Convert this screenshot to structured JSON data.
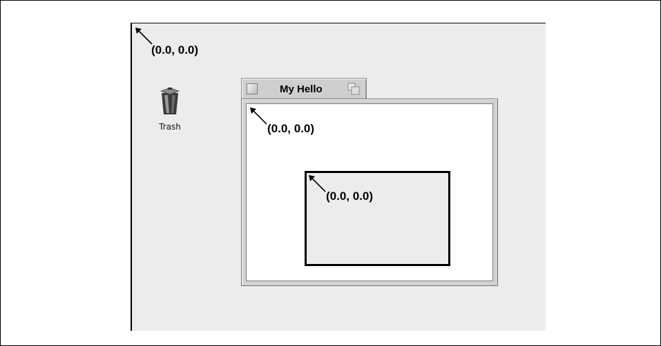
{
  "desktop": {
    "origin_label": "(0.0, 0.0)",
    "trash": {
      "label": "Trash",
      "icon": "trash-can-icon"
    }
  },
  "window": {
    "title": "My Hello",
    "close_icon": "close-box-icon",
    "zoom_icon": "zoom-box-icon",
    "origin_label": "(0.0, 0.0)",
    "view": {
      "origin_label": "(0.0, 0.0)"
    }
  }
}
